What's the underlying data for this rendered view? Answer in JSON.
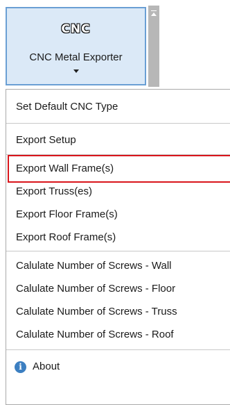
{
  "ribbon": {
    "logo_text": "CNC",
    "button_label": "CNC Metal Exporter"
  },
  "menu": {
    "items": [
      {
        "label": "Set Default CNC Type"
      },
      {
        "label": "Export Setup"
      },
      {
        "label": "Export Wall Frame(s)"
      },
      {
        "label": "Export Truss(es)"
      },
      {
        "label": "Export Floor Frame(s)"
      },
      {
        "label": "Export Roof Frame(s)"
      },
      {
        "label": "Calulate Number of Screws - Wall"
      },
      {
        "label": "Calulate Number of Screws - Floor"
      },
      {
        "label": "Calulate Number of Screws - Truss"
      },
      {
        "label": "Calulate Number of Screws - Roof"
      },
      {
        "label": "About"
      }
    ],
    "about_icon_glyph": "i"
  },
  "colors": {
    "button_bg": "#dbe9f7",
    "button_border": "#6a9fd4",
    "highlight_border": "#d9151b",
    "about_icon": "#3c7fc1"
  }
}
